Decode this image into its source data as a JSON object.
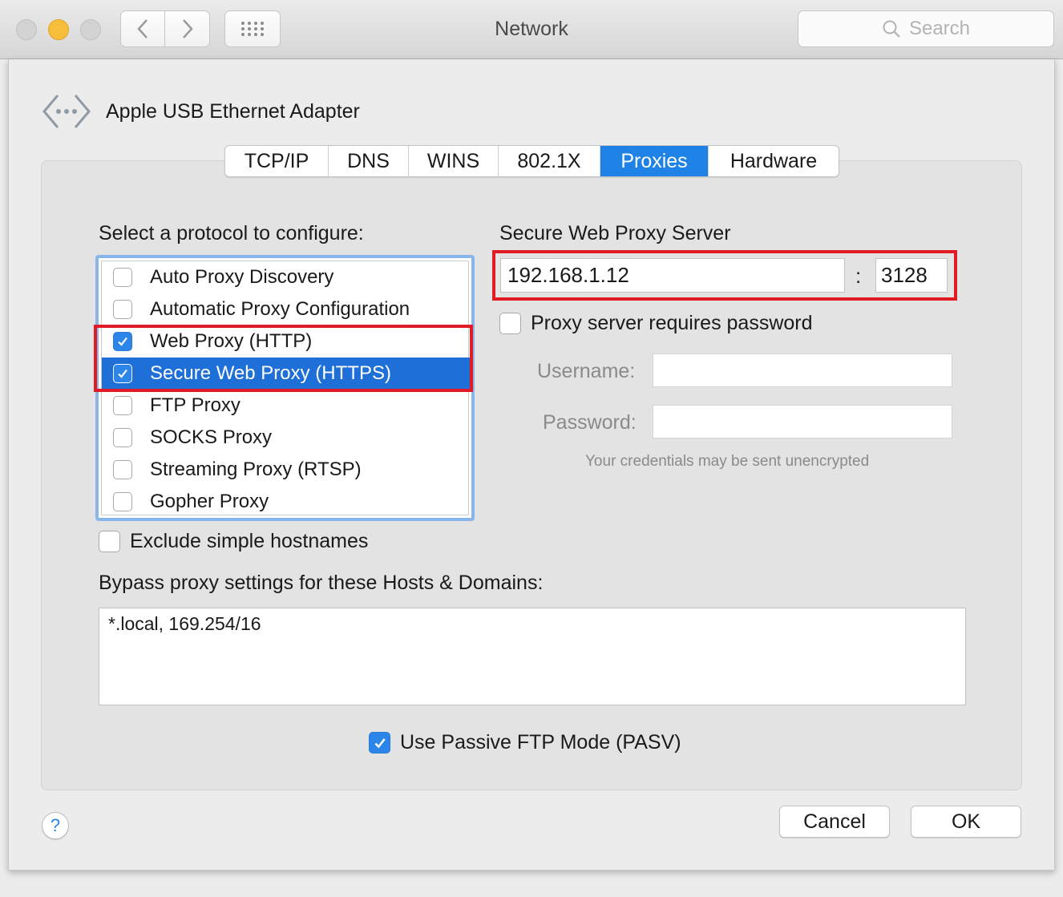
{
  "window": {
    "title": "Network"
  },
  "toolbar": {
    "search_placeholder": "Search"
  },
  "adapter": {
    "name": "Apple USB Ethernet Adapter"
  },
  "tabs": [
    {
      "label": "TCP/IP"
    },
    {
      "label": "DNS"
    },
    {
      "label": "WINS"
    },
    {
      "label": "802.1X"
    },
    {
      "label": "Proxies",
      "selected": true
    },
    {
      "label": "Hardware"
    }
  ],
  "protocols": {
    "heading": "Select a protocol to configure:",
    "items": [
      {
        "label": "Auto Proxy Discovery",
        "checked": false
      },
      {
        "label": "Automatic Proxy Configuration",
        "checked": false
      },
      {
        "label": "Web Proxy (HTTP)",
        "checked": true
      },
      {
        "label": "Secure Web Proxy (HTTPS)",
        "checked": true,
        "selected": true
      },
      {
        "label": "FTP Proxy",
        "checked": false
      },
      {
        "label": "SOCKS Proxy",
        "checked": false
      },
      {
        "label": "Streaming Proxy (RTSP)",
        "checked": false
      },
      {
        "label": "Gopher Proxy",
        "checked": false
      }
    ]
  },
  "server": {
    "heading": "Secure Web Proxy Server",
    "host": "192.168.1.12",
    "separator": ":",
    "port": "3128",
    "requires_password_label": "Proxy server requires password",
    "requires_password": false,
    "username_label": "Username:",
    "password_label": "Password:",
    "username_value": "",
    "password_value": "",
    "warning": "Your credentials may be sent unencrypted"
  },
  "exclude_simple_label": "Exclude simple hostnames",
  "exclude_simple": false,
  "bypass": {
    "heading": "Bypass proxy settings for these Hosts & Domains:",
    "value": "*.local, 169.254/16"
  },
  "passive_ftp_label": "Use Passive FTP Mode (PASV)",
  "passive_ftp": true,
  "buttons": {
    "cancel": "Cancel",
    "ok": "OK",
    "help": "?"
  },
  "colors": {
    "accent": "#1e82e6",
    "highlight_box": "#e01b24",
    "selection": "#1e6fd8"
  }
}
